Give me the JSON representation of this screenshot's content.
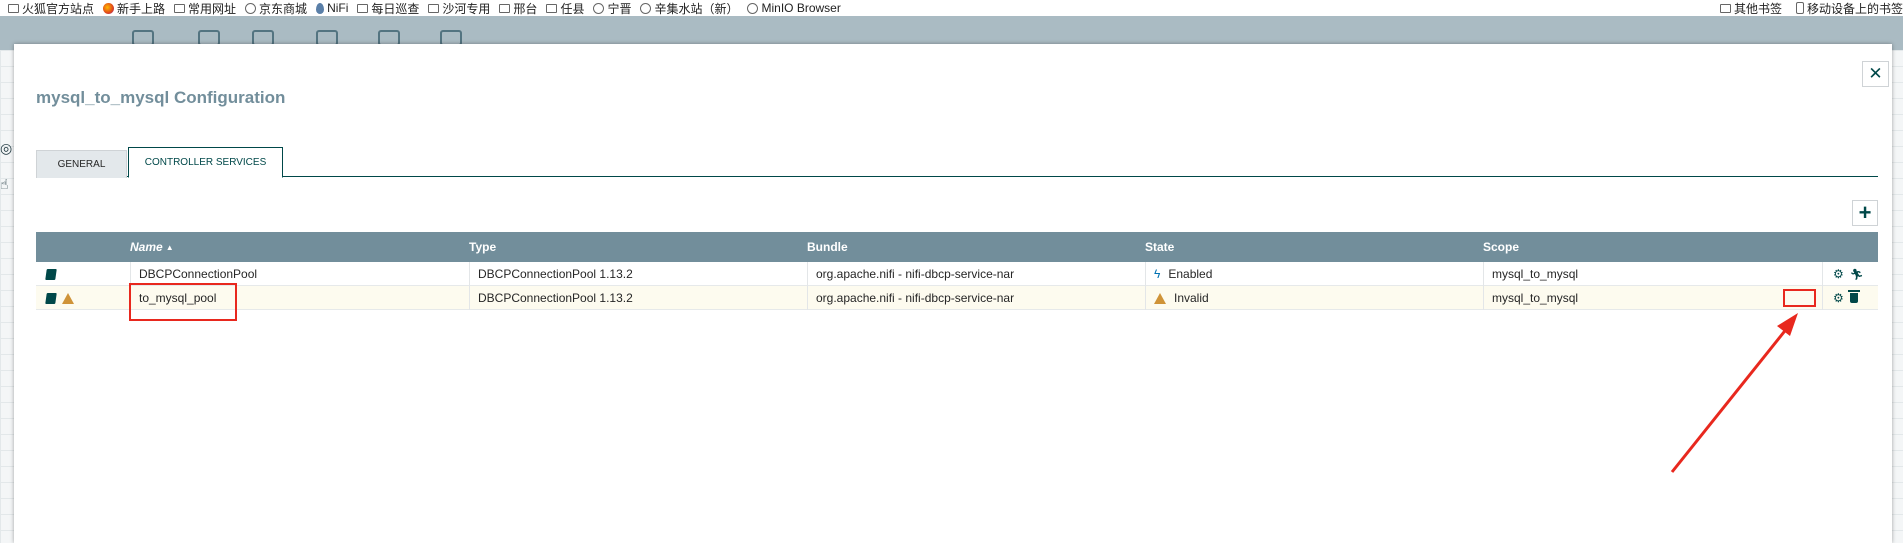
{
  "bookmarks": {
    "items": [
      {
        "label": "火狐官方站点",
        "icon": "folder-icon"
      },
      {
        "label": "新手上路",
        "icon": "firefox-icon"
      },
      {
        "label": "常用网址",
        "icon": "folder-icon"
      },
      {
        "label": "京东商城",
        "icon": "globe-icon"
      },
      {
        "label": "NiFi",
        "icon": "nifi-drop-icon"
      },
      {
        "label": "每日巡查",
        "icon": "folder-icon"
      },
      {
        "label": "沙河专用",
        "icon": "folder-icon"
      },
      {
        "label": "邢台",
        "icon": "folder-icon"
      },
      {
        "label": "任县",
        "icon": "folder-icon"
      },
      {
        "label": "宁晋",
        "icon": "globe-icon"
      },
      {
        "label": "辛集水站（新）",
        "icon": "globe-icon"
      },
      {
        "label": "MinIO Browser",
        "icon": "globe-icon"
      }
    ],
    "other": "其他书签",
    "mobile": "移动设备上的书签"
  },
  "dialog": {
    "title": "mysql_to_mysql Configuration",
    "close_label": "✕",
    "tabs": [
      {
        "label": "GENERAL",
        "active": false
      },
      {
        "label": "CONTROLLER SERVICES",
        "active": true
      }
    ],
    "add_label": "+"
  },
  "table": {
    "columns": [
      "Name",
      "Type",
      "Bundle",
      "State",
      "Scope"
    ],
    "sort_indicator": "▲",
    "rows": [
      {
        "name": "DBCPConnectionPool",
        "type": "DBCPConnectionPool 1.13.2",
        "bundle": "org.apache.nifi - nifi-dbcp-service-nar",
        "state": "Enabled",
        "scope": "mysql_to_mysql"
      },
      {
        "name": "to_mysql_pool",
        "type": "DBCPConnectionPool 1.13.2",
        "bundle": "org.apache.nifi - nifi-dbcp-service-nar",
        "state": "Invalid",
        "scope": "mysql_to_mysql"
      }
    ]
  },
  "colors": {
    "header_bg": "#728e9b",
    "accent": "#004849",
    "annotation": "#e8281e"
  }
}
